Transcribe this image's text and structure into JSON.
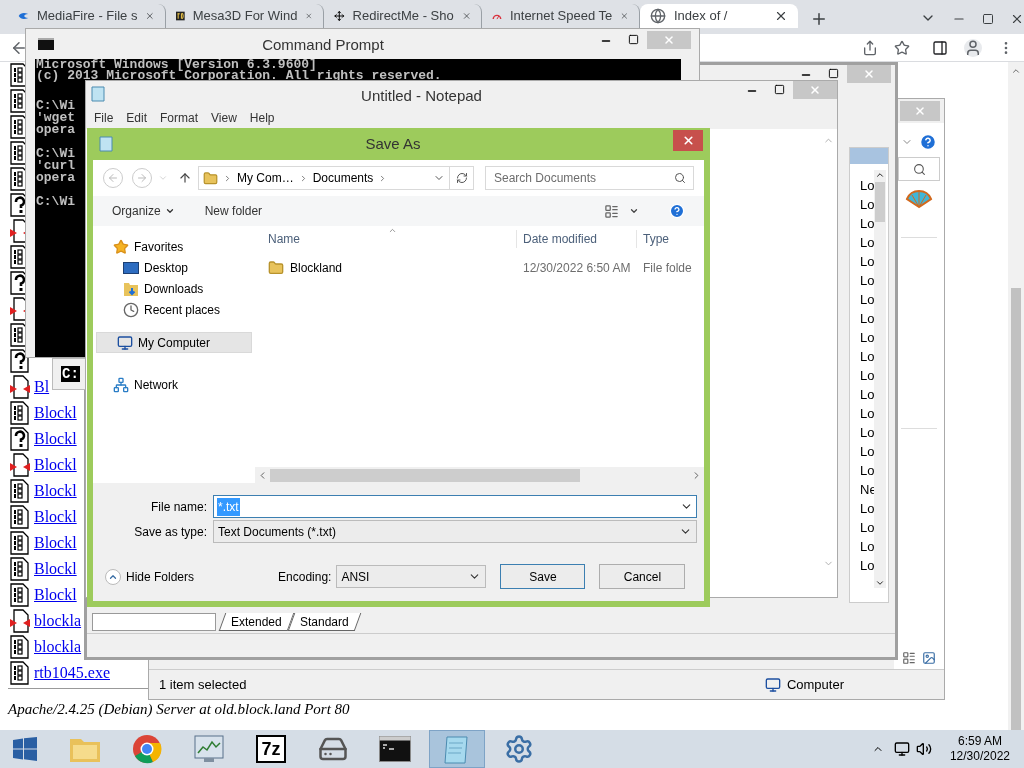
{
  "browser": {
    "tabs": [
      {
        "title": "MediaFire - File s",
        "kind": "mediafire",
        "selected": false
      },
      {
        "title": "Mesa3D For Wind",
        "kind": "fd",
        "selected": false
      },
      {
        "title": "RedirectMe - Sho",
        "kind": "move",
        "selected": false
      },
      {
        "title": "Internet Speed Te",
        "kind": "speed",
        "selected": false
      },
      {
        "title": "Index of /",
        "kind": "globe",
        "selected": true
      }
    ]
  },
  "page": {
    "files": [
      {
        "kind": "binary"
      },
      {
        "kind": "binary"
      },
      {
        "kind": "binary"
      },
      {
        "kind": "binary"
      },
      {
        "kind": "binary"
      },
      {
        "kind": "unknown"
      },
      {
        "kind": "media"
      },
      {
        "kind": "binary"
      },
      {
        "kind": "unknown"
      },
      {
        "kind": "media"
      },
      {
        "kind": "binary"
      },
      {
        "kind": "unknown"
      },
      {
        "kind": "media",
        "name": "Bl"
      },
      {
        "kind": "binary",
        "name": "Blockl"
      },
      {
        "kind": "unknown",
        "name": "Blockl"
      },
      {
        "kind": "media",
        "name": "Blockl"
      },
      {
        "kind": "binary",
        "name": "Blockl"
      },
      {
        "kind": "binary",
        "name": "Blockl"
      },
      {
        "kind": "binary",
        "name": "Blockl"
      },
      {
        "kind": "binary",
        "name": "Blockl"
      },
      {
        "kind": "binary",
        "name": "Blockl"
      },
      {
        "kind": "media",
        "name": "blockla"
      },
      {
        "kind": "binary",
        "name": "blockla"
      },
      {
        "kind": "binary",
        "name": "rtb1045.exe"
      }
    ],
    "footer": "Apache/2.4.25 (Debian) Server at old.block.land Port 80"
  },
  "explorer": {
    "status": "1 item selected",
    "location": "Computer"
  },
  "editor": {
    "list": [
      "Lo",
      "Lo",
      "Lo",
      "Lo",
      "Lo",
      "Lo",
      "Lo",
      "Lo",
      "Lo",
      "Lo",
      "Lo",
      "Lo",
      "Lo",
      "Lo",
      "Lo",
      "Lo",
      "Ne",
      "Lo",
      "Lo",
      "Lo",
      "Lo"
    ],
    "tabs": [
      "Extended",
      "Standard"
    ]
  },
  "cmd": {
    "title": "Command Prompt",
    "groups": [
      [
        "Microsoft Windows [Version 6.3.9600]",
        "(c) 2013 Microsoft Corporation. All rights reserved."
      ],
      [
        "C:\\Wi",
        "'wget",
        "opera"
      ],
      [
        "C:\\Wi",
        "'curl",
        "opera"
      ],
      [
        "C:\\Wi"
      ]
    ],
    "tag": "C:"
  },
  "notepad": {
    "title": "Untitled - Notepad",
    "menu": [
      "File",
      "Edit",
      "Format",
      "View",
      "Help"
    ]
  },
  "save_as": {
    "title": "Save As",
    "path": [
      "My Com…",
      "Documents"
    ],
    "search_placeholder": "Search Documents",
    "organize": "Organize",
    "new_folder": "New folder",
    "nav": [
      {
        "label": "Favorites",
        "kind": "star",
        "selected": false
      },
      {
        "label": "Desktop",
        "kind": "desktop",
        "selected": false
      },
      {
        "label": "Downloads",
        "kind": "downloads",
        "selected": false
      },
      {
        "label": "Recent places",
        "kind": "recent",
        "selected": false
      },
      {
        "label": "My Computer",
        "kind": "computer",
        "selected": true
      },
      {
        "label": "Network",
        "kind": "network",
        "selected": false
      }
    ],
    "columns": [
      "Name",
      "Date modified",
      "Type"
    ],
    "rows": [
      {
        "name": "Blockland",
        "date": "12/30/2022 6:50 AM",
        "type": "File folde"
      }
    ],
    "file_name_label": "File name:",
    "file_name": "*.txt",
    "type_label": "Save as type:",
    "type": "Text Documents (*.txt)",
    "hide_folders": "Hide Folders",
    "encoding_label": "Encoding:",
    "encoding": "ANSI",
    "buttons": [
      "Save",
      "Cancel"
    ]
  },
  "taskbar": {
    "apps": [
      {
        "kind": "explorer",
        "selected": false
      },
      {
        "kind": "chrome",
        "selected": false
      },
      {
        "kind": "monitor",
        "selected": false
      },
      {
        "kind": "archive",
        "label": "7z",
        "selected": false
      },
      {
        "kind": "drive",
        "selected": false
      },
      {
        "kind": "cmd",
        "selected": false
      },
      {
        "kind": "notepad",
        "selected": true
      },
      {
        "kind": "settings",
        "selected": false
      }
    ],
    "time": "6:59 AM",
    "date": "12/30/2022"
  }
}
